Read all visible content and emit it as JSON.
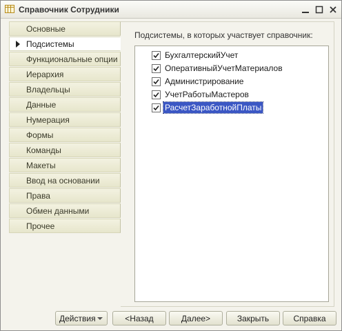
{
  "window": {
    "title": "Справочник Сотрудники",
    "controls": {
      "minimize": "—",
      "maximize": "□",
      "close": "✕"
    }
  },
  "nav": {
    "active_index": 1,
    "items": [
      {
        "label": "Основные"
      },
      {
        "label": "Подсистемы"
      },
      {
        "label": "Функциональные опции"
      },
      {
        "label": "Иерархия"
      },
      {
        "label": "Владельцы"
      },
      {
        "label": "Данные"
      },
      {
        "label": "Нумерация"
      },
      {
        "label": "Формы"
      },
      {
        "label": "Команды"
      },
      {
        "label": "Макеты"
      },
      {
        "label": "Ввод на основании"
      },
      {
        "label": "Права"
      },
      {
        "label": "Обмен данными"
      },
      {
        "label": "Прочее"
      }
    ]
  },
  "content": {
    "label": "Подсистемы, в которых участвует справочник:",
    "subsystems": [
      {
        "label": "БухгалтерскийУчет",
        "checked": true,
        "selected": false
      },
      {
        "label": "ОперативныйУчетМатериалов",
        "checked": true,
        "selected": false
      },
      {
        "label": "Администрирование",
        "checked": true,
        "selected": false
      },
      {
        "label": "УчетРаботыМастеров",
        "checked": true,
        "selected": false
      },
      {
        "label": "РасчетЗаработнойПлаты",
        "checked": true,
        "selected": true
      }
    ]
  },
  "footer": {
    "actions": "Действия",
    "back": "<Назад",
    "next": "Далее>",
    "close": "Закрыть",
    "help": "Справка"
  },
  "colors": {
    "selection": "#3b57c4",
    "tab_background": "#e7e6cc",
    "window_background": "#f4f3ec"
  }
}
